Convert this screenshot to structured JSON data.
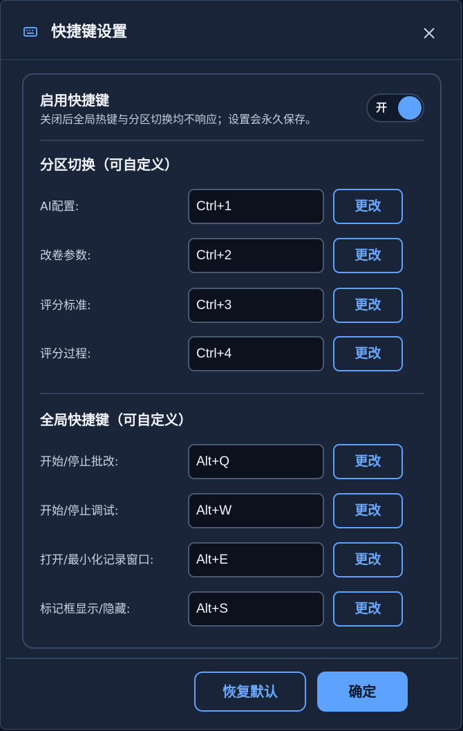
{
  "dialog": {
    "title": "快捷键设置",
    "title_icon": "keyboard-icon",
    "close_icon": "close-icon"
  },
  "enable": {
    "title": "启用快捷键",
    "description": "关闭后全局热键与分区切换均不响应；设置会永久保存。",
    "toggle_label": "开",
    "enabled": true
  },
  "partition": {
    "title": "分区切换（可自定义）",
    "rows": [
      {
        "label": "AI配置:",
        "value": "Ctrl+1",
        "button": "更改"
      },
      {
        "label": "改卷参数:",
        "value": "Ctrl+2",
        "button": "更改"
      },
      {
        "label": "评分标准:",
        "value": "Ctrl+3",
        "button": "更改"
      },
      {
        "label": "评分过程:",
        "value": "Ctrl+4",
        "button": "更改"
      }
    ]
  },
  "global": {
    "title": "全局快捷键（可自定义）",
    "rows": [
      {
        "label": "开始/停止批改:",
        "value": "Alt+Q",
        "button": "更改"
      },
      {
        "label": "开始/停止调试:",
        "value": "Alt+W",
        "button": "更改"
      },
      {
        "label": "打开/最小化记录窗口:",
        "value": "Alt+E",
        "button": "更改"
      },
      {
        "label": "标记框显示/隐藏:",
        "value": "Alt+S",
        "button": "更改"
      }
    ]
  },
  "footer": {
    "restore_label": "恢复默认",
    "ok_label": "确定"
  },
  "colors": {
    "accent": "#5ea2ff",
    "background": "#1a2438",
    "input_bg": "#0b111d"
  }
}
